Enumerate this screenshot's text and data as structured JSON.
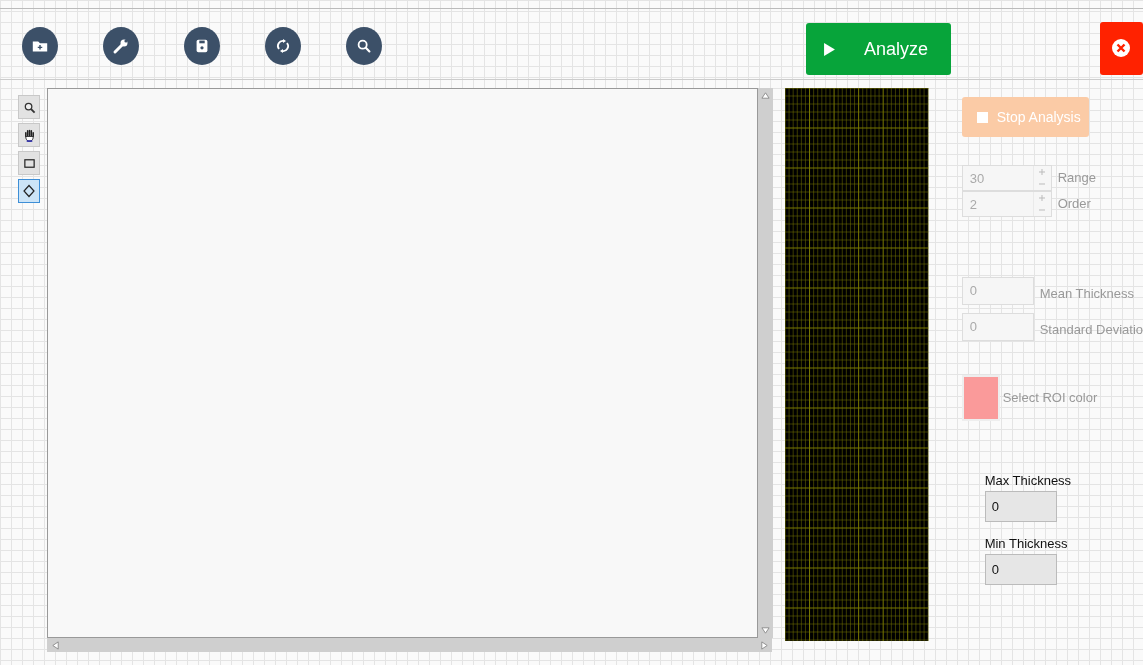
{
  "toolbar": {
    "icon_buttons": [
      {
        "kind": "folder-add"
      },
      {
        "kind": "wrench"
      },
      {
        "kind": "save"
      },
      {
        "kind": "refresh"
      },
      {
        "kind": "search"
      }
    ],
    "analyze_button": {
      "label": "Analyze"
    }
  },
  "tools": [
    {
      "kind": "zoom",
      "selected": false
    },
    {
      "kind": "pan",
      "selected": false
    },
    {
      "kind": "rectangle",
      "selected": false
    },
    {
      "kind": "diamond",
      "selected": true
    }
  ],
  "stop_button": {
    "label": "Stop Analysis",
    "disabled": true
  },
  "spinners": [
    {
      "value": "30",
      "label": "Range",
      "disabled": true
    },
    {
      "value": "2",
      "label": "Order",
      "disabled": true
    }
  ],
  "stats": [
    {
      "value": "0",
      "label": "Mean Thickness",
      "disabled": true
    },
    {
      "value": "0",
      "label": "Standard Deviatio",
      "disabled": true
    }
  ],
  "roi": {
    "label": "Select ROI color",
    "color": "#fa9a9a"
  },
  "thickness": [
    {
      "label": "Max Thickness",
      "value": "0"
    },
    {
      "label": "Min Thickness",
      "value": "0"
    }
  ]
}
